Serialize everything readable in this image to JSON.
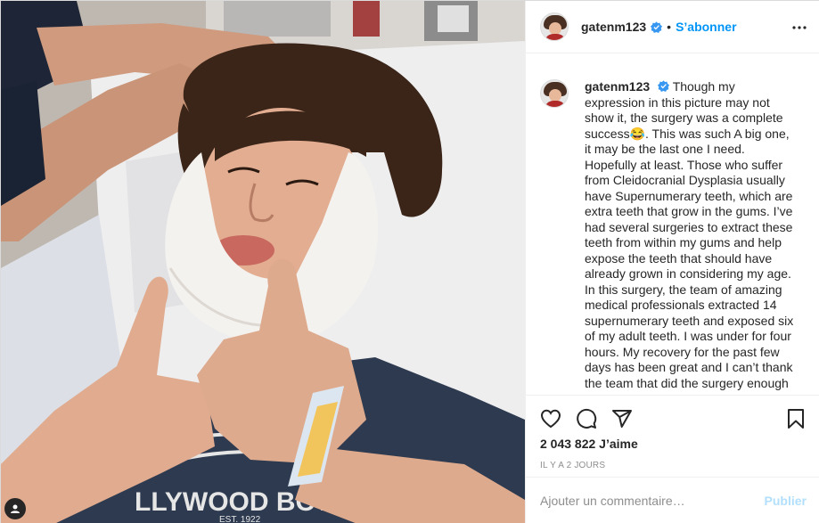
{
  "post": {
    "username": "gatenm123",
    "dot": "•",
    "follow_label": "S’abonner",
    "caption": "Though my expression in this picture may not show it, the surgery was a complete success😂. This was such A big one, it may be the last one I need. Hopefully at least. Those who suffer from Cleidocranial Dysplasia usually have Supernumerary teeth, which are extra teeth that grow in the gums. I’ve had several surgeries to extract these teeth from within my gums and help expose the teeth that should have already grown in considering my age. In this surgery, the team of amazing medical professionals extracted 14 supernumerary teeth and exposed six of my adult teeth. I was under for four hours. My recovery for the past few days has been great and I can’t thank the team that did the surgery enough",
    "likes": "2 043 822 J’aime",
    "time": "IL Y A 2 JOURS",
    "comment_placeholder": "Ajouter un commentaire…",
    "publish_label": "Publier",
    "shirt_text": "LLYWOOD BOWL",
    "shirt_est": "EST. 1922"
  },
  "icons": {
    "more": "more-options-icon",
    "like": "heart-icon",
    "comment": "comment-icon",
    "share": "share-icon",
    "save": "bookmark-icon",
    "verified": "verified-badge-icon"
  },
  "colors": {
    "accent": "#0095f6",
    "publish_disabled": "#b2dffc",
    "muted": "#8e8e8e"
  }
}
